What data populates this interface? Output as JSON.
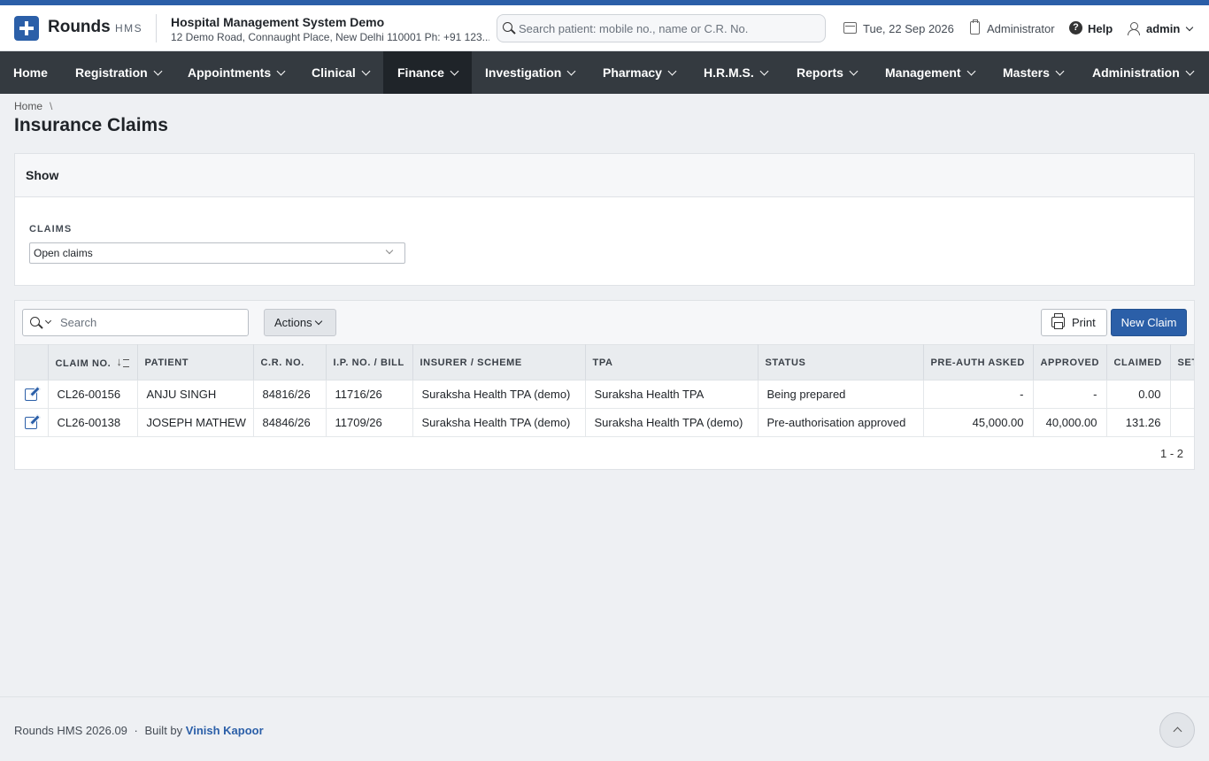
{
  "header": {
    "brand": "Rounds",
    "brand_sub": "HMS",
    "hospital_name": "Hospital Management System Demo",
    "hospital_address": "12 Demo Road, Connaught Place, New Delhi 110001 Ph: +91 123...",
    "search_placeholder": "Search patient: mobile no., name or C.R. No.",
    "date": "Tue, 22 Sep 2026",
    "role": "Administrator",
    "help": "Help",
    "user": "admin"
  },
  "nav": {
    "items": [
      {
        "label": "Home"
      },
      {
        "label": "Registration"
      },
      {
        "label": "Appointments"
      },
      {
        "label": "Clinical"
      },
      {
        "label": "Finance"
      },
      {
        "label": "Investigation"
      },
      {
        "label": "Pharmacy"
      },
      {
        "label": "H.R.M.S."
      },
      {
        "label": "Reports"
      },
      {
        "label": "Management"
      },
      {
        "label": "Masters"
      },
      {
        "label": "Administration"
      }
    ],
    "active": "Finance"
  },
  "breadcrumb": {
    "home": "Home",
    "sep": "\\"
  },
  "page": {
    "title": "Insurance Claims"
  },
  "filter_panel": {
    "heading": "Show",
    "claims_label": "CLAIMS",
    "claims_value": "Open claims"
  },
  "grid": {
    "search_placeholder": "Search",
    "actions_label": "Actions",
    "print_label": "Print",
    "new_label": "New Claim",
    "columns": {
      "claim_no": "Claim No.",
      "patient": "Patient",
      "cr_no": "C.R. No.",
      "ip_bill": "I.P. No. / Bill",
      "insurer": "Insurer / Scheme",
      "tpa": "TPA",
      "status": "Status",
      "preauth": "Pre-Auth Asked",
      "approved": "Approved",
      "claimed": "Claimed",
      "settled": "Settled"
    },
    "rows": [
      {
        "claim_no": "CL26-00156",
        "patient": "ANJU SINGH",
        "cr_no": "84816/26",
        "ip_bill": "11716/26",
        "insurer": "Suraksha Health TPA (demo)",
        "tpa": "Suraksha Health TPA",
        "status": "Being prepared",
        "preauth": "-",
        "approved": "-",
        "claimed": "0.00"
      },
      {
        "claim_no": "CL26-00138",
        "patient": "JOSEPH MATHEW",
        "cr_no": "84846/26",
        "ip_bill": "11709/26",
        "insurer": "Suraksha Health TPA (demo)",
        "tpa": "Suraksha Health TPA (demo)",
        "status": "Pre-authorisation approved",
        "preauth": "45,000.00",
        "approved": "40,000.00",
        "claimed": "131.26"
      }
    ],
    "pager": "1 - 2"
  },
  "footer": {
    "app": "Rounds HMS 2026.09",
    "sep": "·",
    "built_by": "Built by",
    "author": "Vinish Kapoor"
  },
  "colors": {
    "accent": "#2b5fa8",
    "navbar": "#343a40",
    "navbar_active": "#1f2429"
  },
  "icons": [
    "logo-plus-icon",
    "search-icon",
    "calendar-icon",
    "clipboard-icon",
    "help-icon",
    "user-icon",
    "chevron-down-icon",
    "edit-icon",
    "sort-icon",
    "printer-icon",
    "chevron-up-icon"
  ]
}
